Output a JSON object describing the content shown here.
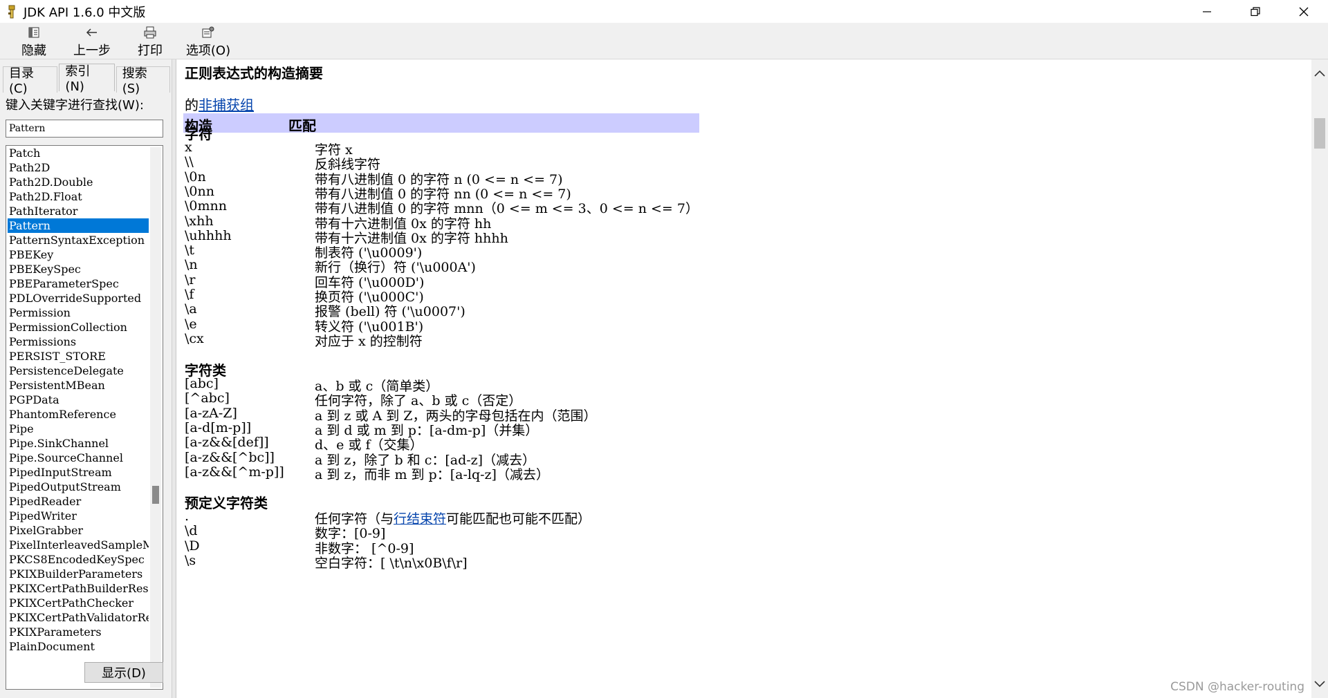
{
  "window": {
    "title": "JDK API 1.6.0 中文版"
  },
  "toolbar": {
    "hide_label": "隐藏",
    "back_label": "上一步",
    "print_label": "打印",
    "options_label": "选项(O)"
  },
  "left": {
    "tabs": [
      {
        "label": "目录(C)"
      },
      {
        "label": "索引(N)"
      },
      {
        "label": "搜索(S)"
      }
    ],
    "find_label": "键入关键字进行查找(W):",
    "find_value": "Pattern",
    "items": [
      "Patch",
      "Path2D",
      "Path2D.Double",
      "Path2D.Float",
      "PathIterator",
      "Pattern",
      "PatternSyntaxException",
      "PBEKey",
      "PBEKeySpec",
      "PBEParameterSpec",
      "PDLOverrideSupported",
      "Permission",
      "PermissionCollection",
      "Permissions",
      "PERSIST_STORE",
      "PersistenceDelegate",
      "PersistentMBean",
      "PGPData",
      "PhantomReference",
      "Pipe",
      "Pipe.SinkChannel",
      "Pipe.SourceChannel",
      "PipedInputStream",
      "PipedOutputStream",
      "PipedReader",
      "PipedWriter",
      "PixelGrabber",
      "PixelInterleavedSampleM",
      "PKCS8EncodedKeySpec",
      "PKIXBuilderParameters",
      "PKIXCertPathBuilderRes",
      "PKIXCertPathChecker",
      "PKIXCertPathValidatorRe",
      "PKIXParameters",
      "PlainDocument"
    ],
    "selected_index": 5,
    "show_button": "显示(D)"
  },
  "content": {
    "summary_title": "正则表达式的构造摘要",
    "intro_prefix": "的",
    "intro_link": "非捕获组",
    "col_construct": "构造",
    "col_match": "匹配",
    "sections": {
      "chars": {
        "title": "字符",
        "rows": [
          {
            "c": "x",
            "m": "字符 x"
          },
          {
            "c": "\\\\",
            "m": "反斜线字符"
          },
          {
            "c": "\\0n",
            "m": "带有八进制值 0 的字符 n (0 <= n <= 7)"
          },
          {
            "c": "\\0nn",
            "m": "带有八进制值 0 的字符 nn (0 <= n <= 7)"
          },
          {
            "c": "\\0mnn",
            "m": "带有八进制值 0 的字符 mnn（0 <= m <= 3、0 <= n <= 7）"
          },
          {
            "c": "\\xhh",
            "m": "带有十六进制值 0x 的字符 hh"
          },
          {
            "c": "\\uhhhh",
            "m": "带有十六进制值 0x 的字符 hhhh"
          },
          {
            "c": "\\t",
            "m": "制表符 ('\\u0009')"
          },
          {
            "c": "\\n",
            "m": "新行（换行）符 ('\\u000A')"
          },
          {
            "c": "\\r",
            "m": "回车符 ('\\u000D')"
          },
          {
            "c": "\\f",
            "m": "换页符 ('\\u000C')"
          },
          {
            "c": "\\a",
            "m": "报警 (bell) 符 ('\\u0007')"
          },
          {
            "c": "\\e",
            "m": "转义符 ('\\u001B')"
          },
          {
            "c": "\\cx",
            "m": "对应于 x 的控制符"
          }
        ]
      },
      "classes": {
        "title": "字符类",
        "rows": [
          {
            "c": "[abc]",
            "m": "a、b 或 c（简单类）"
          },
          {
            "c": "[^abc]",
            "m": "任何字符，除了 a、b 或 c（否定）"
          },
          {
            "c": "[a-zA-Z]",
            "m": "a 到 z 或 A 到 Z，两头的字母包括在内（范围）"
          },
          {
            "c": "[a-d[m-p]]",
            "m": "a 到 d 或 m 到 p：[a-dm-p]（并集）"
          },
          {
            "c": "[a-z&&[def]]",
            "m": "d、e 或 f（交集）"
          },
          {
            "c": "[a-z&&[^bc]]",
            "m": "a 到 z，除了 b 和 c：[ad-z]（减去）"
          },
          {
            "c": "[a-z&&[^m-p]]",
            "m": "a 到 z，而非 m 到 p：[a-lq-z]（减去）"
          }
        ]
      },
      "predefined": {
        "title": "预定义字符类",
        "rows": [
          {
            "c": ".",
            "m_prefix": "任何字符（与",
            "m_link": "行结束符",
            "m_suffix": "可能匹配也可能不匹配）"
          },
          {
            "c": "\\d",
            "m": "数字：[0-9]"
          },
          {
            "c": "\\D",
            "m": "非数字： [^0-9]"
          },
          {
            "c": "\\s",
            "m": "空白字符：[ \\t\\n\\x0B\\f\\r]"
          }
        ]
      }
    }
  },
  "watermark": "CSDN @hacker-routing"
}
